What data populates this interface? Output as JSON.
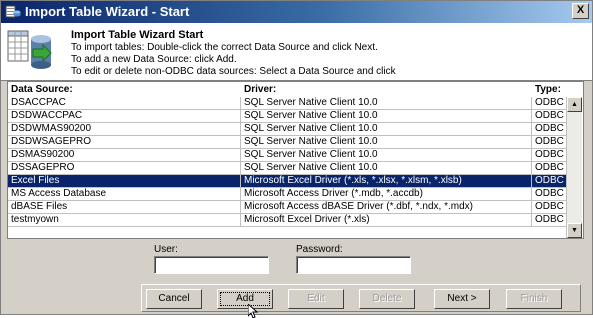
{
  "window": {
    "title": "Import Table Wizard - Start",
    "close_glyph": "X"
  },
  "header": {
    "title": "Import Table Wizard Start",
    "lines": [
      "To import tables: Double-click the correct Data Source and click Next.",
      "To add a new Data Source: click Add.",
      "To edit or delete non-ODBC data sources: Select a Data Source and click"
    ]
  },
  "table": {
    "columns": [
      "Data Source:",
      "Driver:",
      "Type:"
    ],
    "rows": [
      {
        "source": "DSACCPAC",
        "driver": "SQL Server Native Client 10.0",
        "type": "ODBC"
      },
      {
        "source": "DSDWACCPAC",
        "driver": "SQL Server Native Client 10.0",
        "type": "ODBC"
      },
      {
        "source": "DSDWMAS90200",
        "driver": "SQL Server Native Client 10.0",
        "type": "ODBC"
      },
      {
        "source": "DSDWSAGEPRO",
        "driver": "SQL Server Native Client 10.0",
        "type": "ODBC"
      },
      {
        "source": "DSMAS90200",
        "driver": "SQL Server Native Client 10.0",
        "type": "ODBC"
      },
      {
        "source": "DSSAGEPRO",
        "driver": "SQL Server Native Client 10.0",
        "type": "ODBC"
      },
      {
        "source": "Excel Files",
        "driver": "Microsoft Excel Driver (*.xls, *.xlsx, *.xlsm, *.xlsb)",
        "type": "ODBC",
        "selected": true
      },
      {
        "source": "MS Access Database",
        "driver": "Microsoft Access Driver (*.mdb, *.accdb)",
        "type": "ODBC"
      },
      {
        "source": "dBASE Files",
        "driver": "Microsoft Access dBASE Driver (*.dbf, *.ndx, *.mdx)",
        "type": "ODBC"
      },
      {
        "source": "testmyown",
        "driver": "Microsoft Excel Driver (*.xls)",
        "type": "ODBC"
      }
    ]
  },
  "credentials": {
    "user_label": "User:",
    "user_value": "",
    "password_label": "Password:",
    "password_value": ""
  },
  "buttons": {
    "cancel": "Cancel",
    "add": "Add",
    "edit": "Edit",
    "delete": "Delete",
    "next": "Next >",
    "finish": "Finish"
  },
  "icons": {
    "app": "wizard-app-icon",
    "wizard": "database-import-icon",
    "scroll_up": "scroll-up-arrow-icon",
    "scroll_down": "scroll-down-arrow-icon",
    "cursor": "mouse-pointer-icon"
  },
  "colors": {
    "selection": "#0a246a",
    "titlebar_start": "#0a246a",
    "titlebar_end": "#a6caf0"
  }
}
